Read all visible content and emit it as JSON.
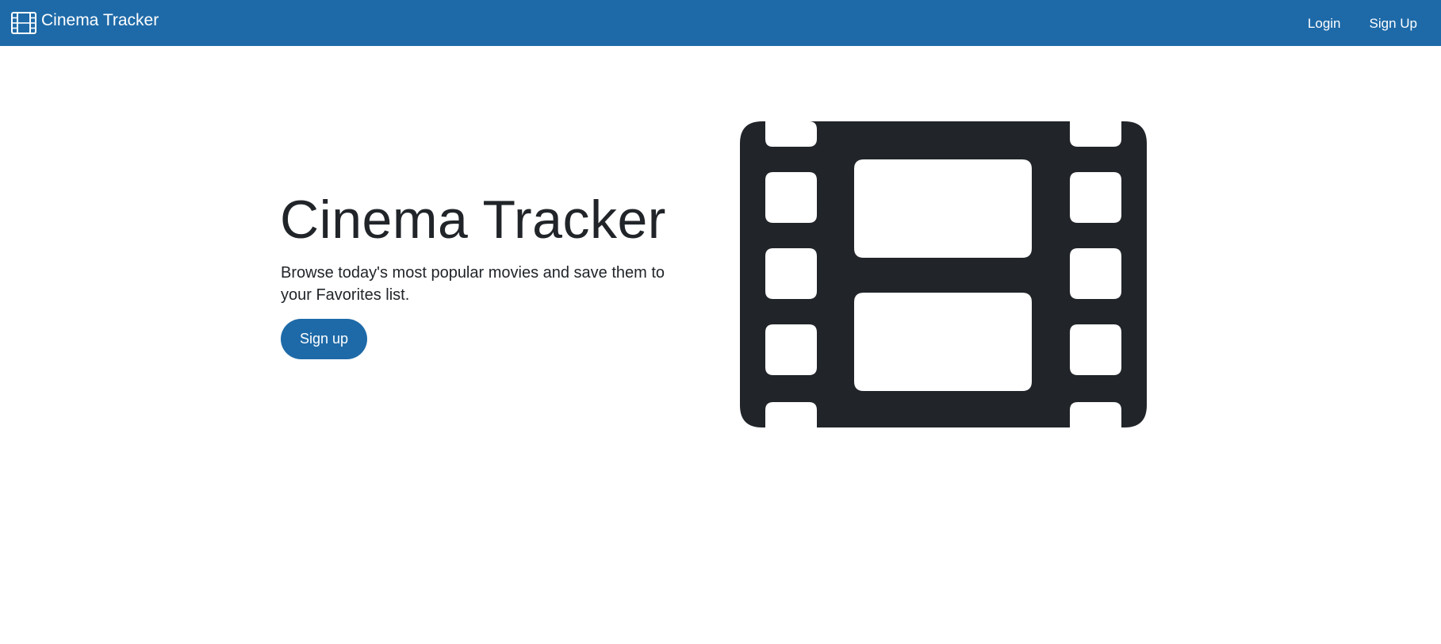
{
  "navbar": {
    "brand": "Cinema Tracker",
    "brand_icon": "film-icon",
    "links": {
      "login": "Login",
      "signup": "Sign Up"
    }
  },
  "hero": {
    "title": "Cinema Tracker",
    "lead": "Browse today's most popular movies and save them to your Favorites list.",
    "cta": "Sign up",
    "illustration_icon": "film-icon"
  },
  "colors": {
    "brand": "#1e6aa8",
    "text": "#212529",
    "background": "#ffffff"
  }
}
